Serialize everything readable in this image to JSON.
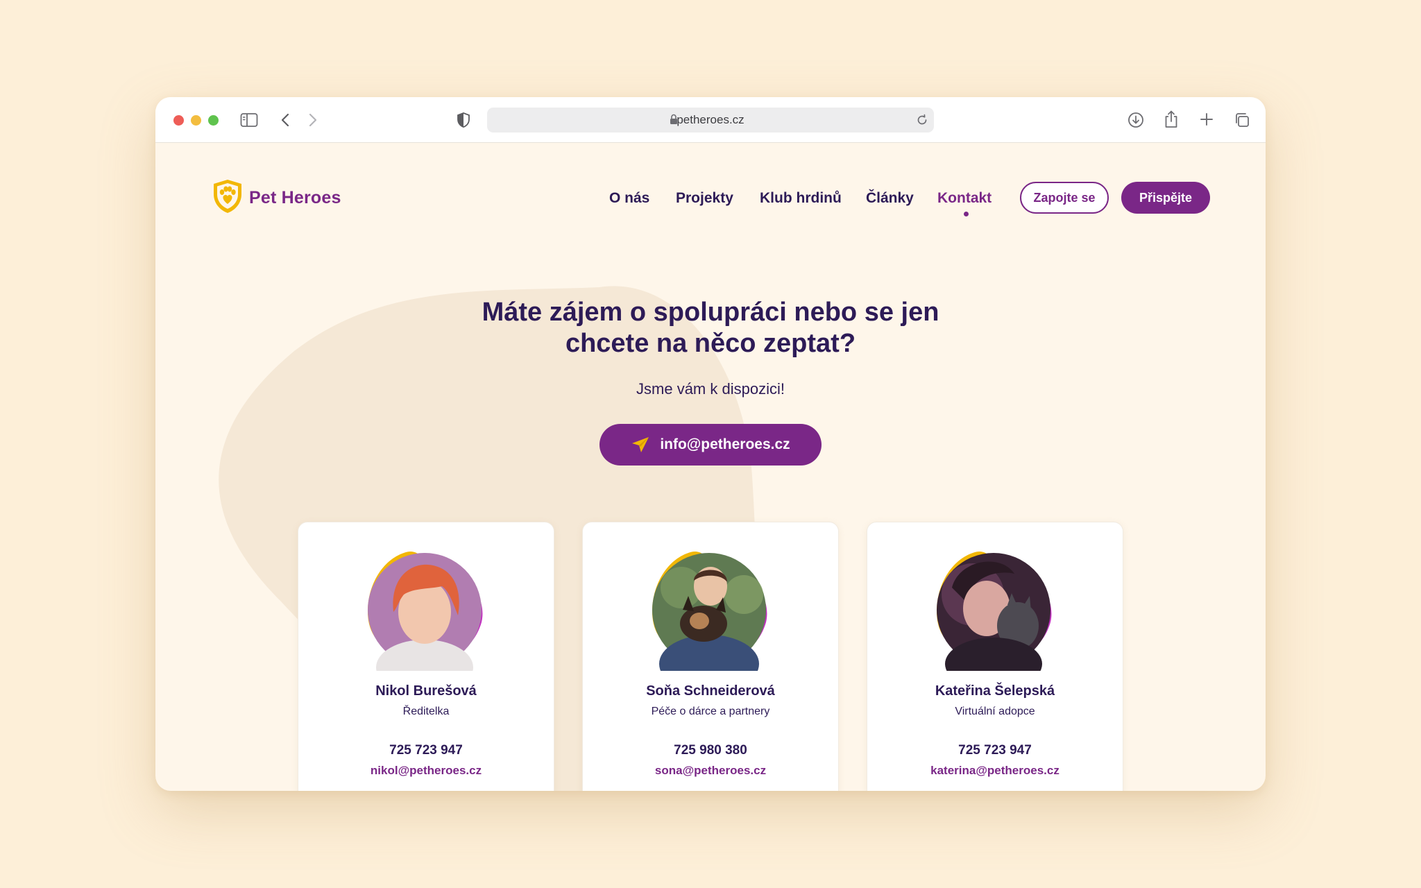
{
  "browser": {
    "url": "petheroes.cz",
    "icons": [
      "sidebar-icon",
      "back-icon",
      "forward-icon",
      "shield-icon",
      "lock-icon",
      "reload-icon",
      "download-icon",
      "share-icon",
      "new-tab-icon",
      "tabs-overview-icon"
    ]
  },
  "brand": {
    "name": "Pet Heroes",
    "accent_color": "#7a2787",
    "logo_color": "#f2b705",
    "text_color": "#2d1b57"
  },
  "nav": {
    "items": [
      {
        "label": "O nás"
      },
      {
        "label": "Projekty"
      },
      {
        "label": "Klub hrdinů"
      },
      {
        "label": "Články"
      },
      {
        "label": "Kontakt",
        "active": true
      }
    ],
    "cta_outline": "Zapojte se",
    "cta_filled": "Přispějte"
  },
  "hero": {
    "title_line1": "Máte zájem o spolupráci nebo se jen",
    "title_line2": "chcete na něco zeptat?",
    "subtitle": "Jsme vám k dispozici!",
    "email_button": "info@petheroes.cz"
  },
  "contacts": [
    {
      "name": "Nikol Burešová",
      "role": "Ředitelka",
      "phone": "725 723 947",
      "email": "nikol@petheroes.cz"
    },
    {
      "name": "Soňa Schneiderová",
      "role": "Péče o dárce a partnery",
      "phone": "725 980 380",
      "email": "sona@petheroes.cz"
    },
    {
      "name": "Kateřina Šelepská",
      "role": "Virtuální adopce",
      "phone": "725 723 947",
      "email": "katerina@petheroes.cz"
    }
  ]
}
